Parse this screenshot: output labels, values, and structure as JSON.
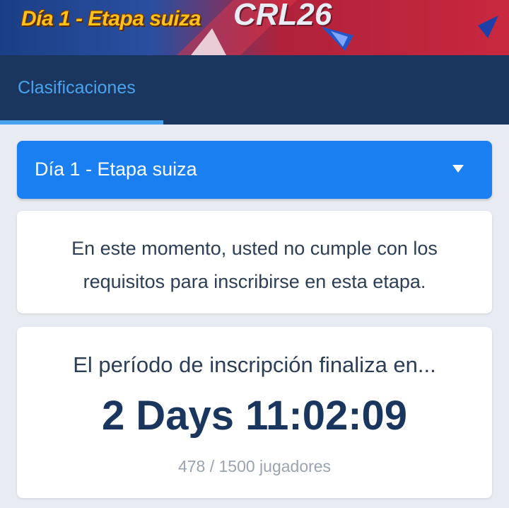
{
  "banner": {
    "title": "Día 1 - Etapa suiza",
    "logo_text": "CRL26"
  },
  "tabs": [
    {
      "label": "Clasificaciones",
      "active": true
    }
  ],
  "stage_select": {
    "value": "Día 1 - Etapa suiza",
    "icon": "chevron-down-icon"
  },
  "notice": {
    "line1": "En este momento, usted no cumple con los",
    "line2": "requisitos para inscribirse en esta etapa."
  },
  "registration": {
    "heading": "El período de inscripción finaliza en...",
    "countdown": "2 Days 11:02:09",
    "players": "478 / 1500 jugadores"
  },
  "colors": {
    "banner_blue": "#1b3f86",
    "banner_red": "#c8283e",
    "title_yellow": "#ffc21a",
    "tabbar_navy": "#1b365e",
    "tab_active_blue": "#4aa3ee",
    "dropdown_blue": "#1a7ff0",
    "page_background": "#e8ecf2",
    "countdown_navy": "#1b365e",
    "muted_gray": "#9aa3af"
  }
}
